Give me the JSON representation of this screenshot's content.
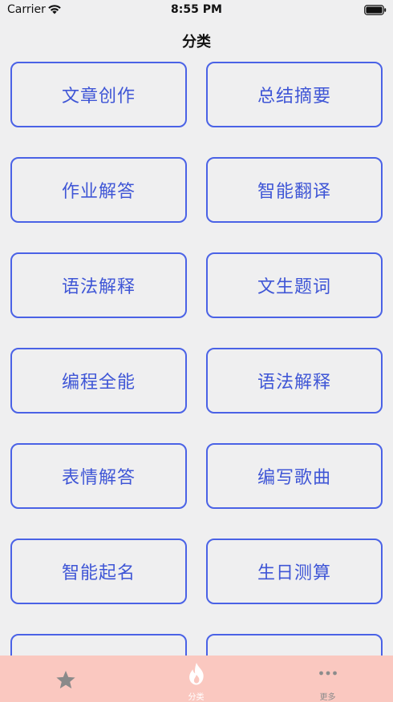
{
  "status_bar": {
    "carrier": "Carrier",
    "time": "8:55 PM"
  },
  "nav": {
    "title": "分类"
  },
  "categories": [
    "文章创作",
    "总结摘要",
    "作业解答",
    "智能翻译",
    "语法解释",
    "文生题词",
    "编程全能",
    "语法解释",
    "表情解答",
    "编写歌曲",
    "智能起名",
    "生日测算",
    "",
    ""
  ],
  "tab_bar": {
    "tabs": [
      {
        "label": "",
        "icon": "star-icon",
        "active": false
      },
      {
        "label": "分类",
        "icon": "flame-icon",
        "active": true
      },
      {
        "label": "更多",
        "icon": "more-icon",
        "active": false
      }
    ]
  },
  "colors": {
    "card_border": "#4a62e6",
    "card_text": "#3f56d6",
    "background": "#efeff0",
    "tab_bar": "#fac8c0"
  }
}
